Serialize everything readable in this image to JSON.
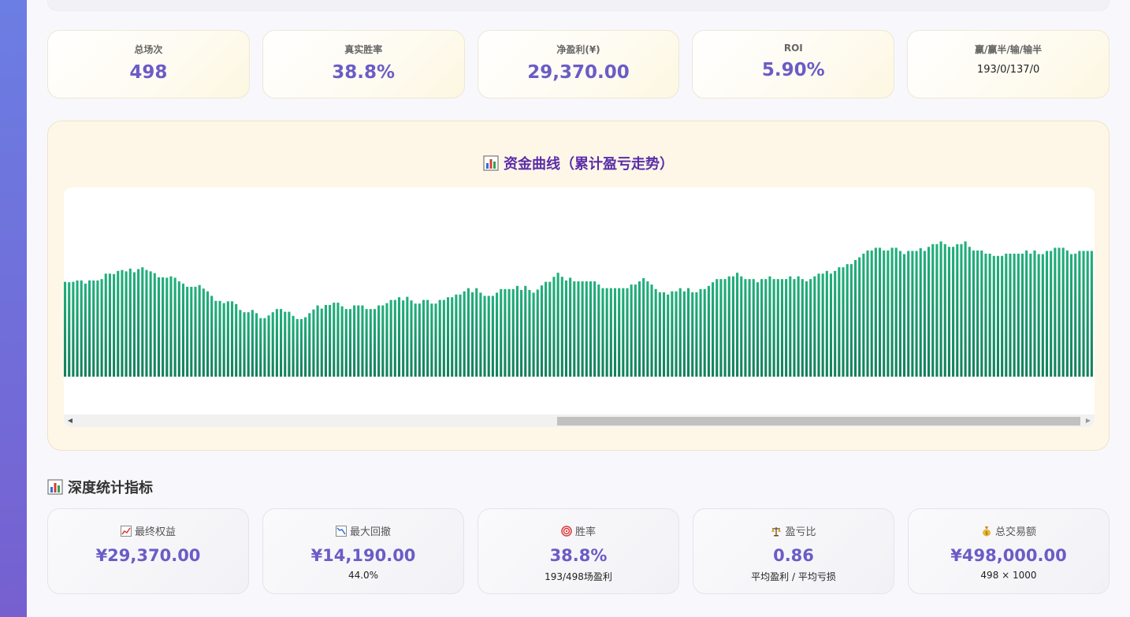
{
  "stats": [
    {
      "label": "总场次",
      "value": "498"
    },
    {
      "label": "真实胜率",
      "value": "38.8%"
    },
    {
      "label": "净盈利(¥)",
      "value": "29,370.00"
    },
    {
      "label": "ROI",
      "value": "5.90%"
    },
    {
      "label": "赢/赢半/输/输半",
      "value": "193/0/137/0"
    }
  ],
  "chart": {
    "title": "资金曲线（累计盈亏走势）",
    "icon": "bar-chart-icon"
  },
  "chart_data": {
    "type": "bar",
    "visible_window": "partial",
    "values": [
      12540,
      12480,
      12540,
      12720,
      12720,
      12300,
      12720,
      12720,
      12720,
      12900,
      13620,
      13620,
      13560,
      13980,
      14100,
      13920,
      14280,
      13800,
      14220,
      14460,
      14100,
      13920,
      13680,
      13140,
      13140,
      13080,
      13260,
      13080,
      12600,
      12300,
      11880,
      11880,
      11880,
      12120,
      11640,
      11280,
      10680,
      10020,
      10020,
      9720,
      9960,
      9960,
      9600,
      8820,
      8520,
      8520,
      8820,
      8400,
      7740,
      7740,
      8100,
      8520,
      8940,
      8940,
      8580,
      8580,
      8040,
      7620,
      7620,
      7860,
      8400,
      8880,
      9420,
      9000,
      9480,
      9480,
      9780,
      9780,
      9300,
      8940,
      8940,
      9420,
      9420,
      9420,
      8940,
      8940,
      8940,
      9420,
      9420,
      9720,
      10140,
      10140,
      10500,
      10080,
      10560,
      10080,
      9660,
      9660,
      10140,
      10140,
      9660,
      9660,
      10140,
      10140,
      10500,
      10500,
      10860,
      10860,
      11280,
      11700,
      11160,
      11700,
      11100,
      10680,
      10680,
      10680,
      11100,
      11580,
      11580,
      11580,
      11580,
      12000,
      11460,
      12000,
      11460,
      11100,
      11520,
      12060,
      12540,
      12540,
      13200,
      13740,
      13200,
      12720,
      13080,
      12600,
      12600,
      12600,
      12600,
      12600,
      12600,
      12180,
      11700,
      11700,
      11700,
      11700,
      11700,
      11700,
      11700,
      12180,
      12180,
      12600,
      13020,
      12600,
      12180,
      11580,
      11160,
      11160,
      10860,
      11280,
      11280,
      11700,
      11280,
      11700,
      11160,
      11160,
      11580,
      11580,
      12000,
      12480,
      12900,
      12900,
      12900,
      13260,
      13260,
      13740,
      13260,
      12900,
      12900,
      12900,
      12480,
      12900,
      12900,
      13260,
      12900,
      12900,
      12900,
      12900,
      13260,
      12900,
      13260,
      12900,
      12600,
      12900,
      13260,
      13620,
      13620,
      13980,
      13620,
      13980,
      14460,
      14460,
      14880,
      14880,
      15420,
      15780,
      16260,
      16680,
      16680,
      17040,
      17040,
      16680,
      16680,
      17040,
      17040,
      16620,
      16200,
      16620,
      16620,
      16620,
      16980,
      16620,
      17160,
      17520,
      17520,
      17880,
      17520,
      17160,
      17160,
      17520,
      17520,
      17880,
      17160,
      16680,
      16680,
      16680,
      16260,
      16260,
      15960,
      15960,
      15960,
      16260,
      16260,
      16260,
      16260,
      16260,
      16680,
      16260,
      16680,
      16200,
      16200,
      16620,
      16620,
      17040,
      17040,
      17040,
      16680,
      16200,
      16260,
      16620,
      16620,
      16620,
      16620
    ],
    "ylim": [
      0,
      25000
    ],
    "grid": false,
    "legend": "none",
    "colors": {
      "top": "#22b07d",
      "bottom": "#12805c"
    }
  },
  "section": {
    "title": "深度统计指标",
    "icon": "bar-chart-icon"
  },
  "metrics": [
    {
      "icon": "chart-up-icon",
      "label": "最终权益",
      "value": "¥29,370.00",
      "sub": ""
    },
    {
      "icon": "chart-down-icon",
      "label": "最大回撤",
      "value": "¥14,190.00",
      "sub": "44.0%"
    },
    {
      "icon": "target-icon",
      "label": "胜率",
      "value": "38.8%",
      "sub": "193/498场盈利"
    },
    {
      "icon": "scales-icon",
      "label": "盈亏比",
      "value": "0.86",
      "sub": "平均盈利 / 平均亏损"
    },
    {
      "icon": "money-bag-icon",
      "label": "总交易额",
      "value": "¥498,000.00",
      "sub": "498 × 1000"
    }
  ],
  "colors": {
    "accent": "#6b5cc6",
    "title": "#5a2da8",
    "sidebar": "#6b7ee3"
  }
}
